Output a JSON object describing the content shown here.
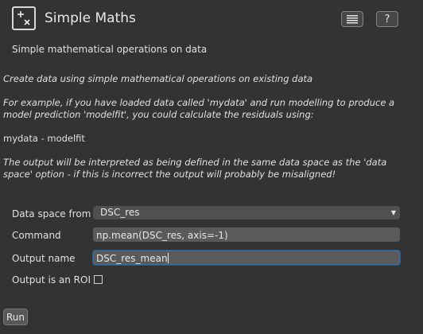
{
  "header": {
    "title": "Simple Maths",
    "logo_icon": "plus-times-icon",
    "docs_icon": "list-icon",
    "help_label": "?"
  },
  "subtitle": "Simple mathematical operations on data",
  "description": {
    "p1": "Create data using simple mathematical operations on existing data",
    "p2": "For example, if you have loaded data called 'mydata' and run modelling to produce a model prediction 'modelfit', you could calculate the residuals using:",
    "p3": "mydata - modelfit",
    "p4": "The output will be interpreted as being defined in the same data space as the 'data space' option - if this is incorrect the output will probably be misaligned!"
  },
  "form": {
    "data_space": {
      "label": "Data space from",
      "value": "DSC_res"
    },
    "command": {
      "label": "Command",
      "value": "np.mean(DSC_res, axis=-1)"
    },
    "output_name": {
      "label": "Output name",
      "value": "DSC_res_mean"
    },
    "output_roi": {
      "label": "Output is an ROI",
      "checked": false
    }
  },
  "run_label": "Run",
  "colors": {
    "background": "#333333",
    "focus_border": "#3d6f9e"
  }
}
